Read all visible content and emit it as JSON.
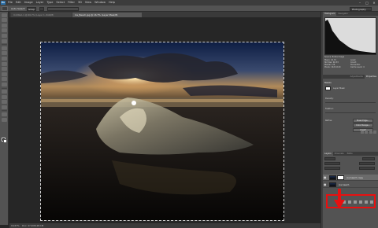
{
  "app": {
    "logo": "Ps"
  },
  "menu": [
    "File",
    "Edit",
    "Image",
    "Layer",
    "Type",
    "Select",
    "Filter",
    "3D",
    "View",
    "Window",
    "Help"
  ],
  "window_controls": [
    "–",
    "□",
    "✕"
  ],
  "options_bar": {
    "label": "Auto-Select:",
    "value": "Group",
    "workspace": "Photography"
  },
  "tabs": [
    {
      "label": "Untitled-1 @ 66.7% (Layer 1, RGB/8)"
    },
    {
      "label": "Ice_Beach.jpg @ 16.7% (Layer Mask/8)"
    }
  ],
  "status": {
    "zoom": "16.67%",
    "doc": "Doc: 47.4M/128.1M"
  },
  "panels": {
    "top_tabs": [
      "Histogram",
      "Navigator"
    ],
    "histogram_info": {
      "source": "Source: Entire Image",
      "rows": [
        "Mean: 41.72",
        "Std Dev: 46.33",
        "Median: 26",
        "Pixels: 14211144"
      ],
      "rows_right": [
        "Level:",
        "Count:",
        "Percentile:",
        "Cache Level: 4"
      ]
    },
    "prop_tabs": [
      "Adjustments",
      "Properties"
    ],
    "properties": {
      "title": "Masks",
      "mask_label": "Layer Mask",
      "density_label": "Density:",
      "feather_label": "Feather:",
      "refine_label": "Refine:",
      "btn_edge": "Mask Edge...",
      "btn_range": "Color Range...",
      "btn_invert": "Invert"
    },
    "layer_tabs": [
      "Layers",
      "Channels",
      "Paths"
    ],
    "layers": [
      {
        "name": "ice beach copy",
        "selected": true,
        "has_mask": true
      },
      {
        "name": "ice beach",
        "selected": false,
        "has_mask": false
      }
    ]
  },
  "colors": {
    "highlight": "#e81010"
  }
}
